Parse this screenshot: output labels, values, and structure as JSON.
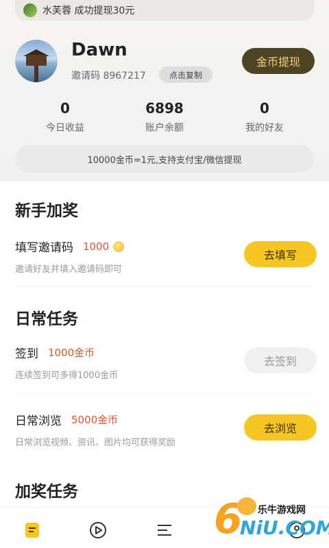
{
  "ticker": {
    "text": "水芙蓉 成功提现30元"
  },
  "profile": {
    "name": "Dawn",
    "invite_label": "邀请码 8967217",
    "copy_label": "点击复制",
    "withdraw_label": "金币提现"
  },
  "stats": [
    {
      "value": "0",
      "label": "今日收益"
    },
    {
      "value": "6898",
      "label": "账户余额"
    },
    {
      "value": "0",
      "label": "我的好友"
    }
  ],
  "rate_text": "10000金币=1元,支持支付宝/微信提现",
  "sections": {
    "newbie": {
      "title": "新手加奖",
      "task": {
        "title": "填写邀请码",
        "reward": "1000",
        "desc": "邀请好友并填入邀请码即可",
        "button": "去填写"
      }
    },
    "daily": {
      "title": "日常任务",
      "tasks": [
        {
          "title": "签到",
          "reward": "1000金币",
          "desc": "连续签到可多得1000金币",
          "button": "去签到"
        },
        {
          "title": "日常浏览",
          "reward": "5000金币",
          "desc": "日常浏览视频、资讯、图片均可获得奖励",
          "button": "去浏览"
        }
      ]
    },
    "bonus": {
      "title": "加奖任务"
    }
  },
  "tabbar": {
    "icons": [
      "task-tab-icon",
      "video-tab-icon",
      "menu-tab-icon",
      "profile-tab-icon"
    ]
  },
  "watermark": {
    "brand": "乐牛游戏网",
    "logo_text": "NiU.COM"
  },
  "colors": {
    "accent_yellow": "#f7c623",
    "reward_red": "#e0552b",
    "withdraw_bg": "#4d4426"
  }
}
